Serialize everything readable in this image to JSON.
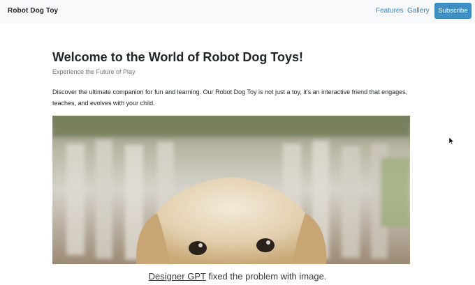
{
  "navbar": {
    "brand": "Robot Dog Toy",
    "links": [
      "Features",
      "Gallery"
    ],
    "subscribe_label": "Subscribe",
    "accent_color": "#3f8fc3"
  },
  "hero": {
    "title": "Welcome to the World of Robot Dog Toys!",
    "subtitle": "Experience the Future of Play",
    "intro": "Discover the ultimate companion for fun and learning. Our Robot Dog Toy is not just a toy, it's an interactive friend that engages, teaches, and evolves with your child."
  },
  "caption": {
    "link_text": "Designer GPT",
    "rest_text": " fixed the problem with image."
  }
}
